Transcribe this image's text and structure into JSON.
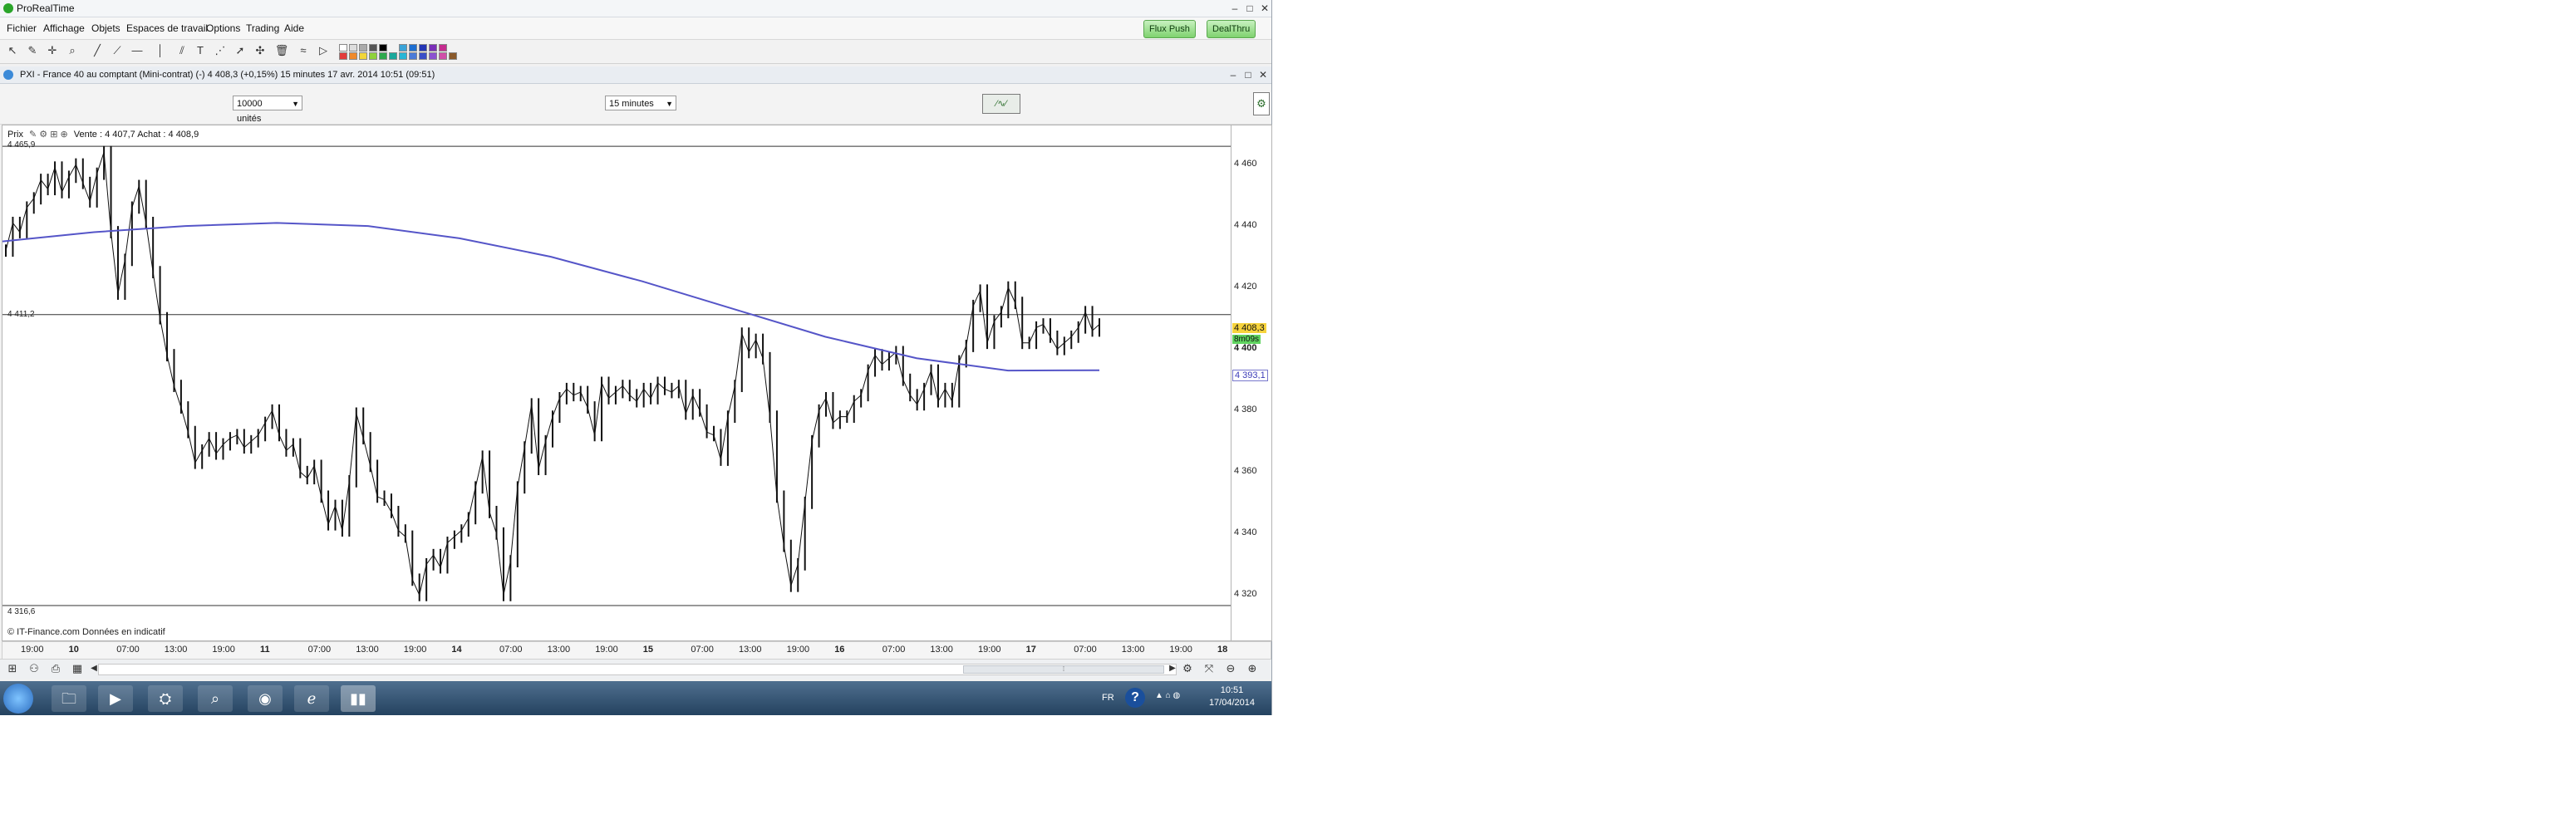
{
  "window": {
    "title": "ProRealTime",
    "controls": [
      "–",
      "□",
      "✕"
    ]
  },
  "menu": {
    "items": [
      "Fichier",
      "Affichage",
      "Objets",
      "Espaces de travail",
      "Options",
      "Trading",
      "Aide"
    ],
    "flux_push": "Flux Push",
    "dealthru": "DealThru"
  },
  "document": {
    "title": "PXI - France 40 au comptant (Mini-contrat)  (-)    4 408,3 (+0,15%)    15 minutes  17 avr. 2014 10:51 (09:51)"
  },
  "controls": {
    "units_value": "10000 unités",
    "timeframe_value": "15 minutes"
  },
  "chart": {
    "legend_label": "Prix",
    "legend_quote": "Vente : 4 407,7  Achat : 4 408,9",
    "line_high_label": "4 465,9",
    "line_mid_label": "4 411,2",
    "line_low_label": "4 316,6",
    "copyright": "© IT-Finance.com  Données en indicatif",
    "price_badge": "4 408,3",
    "countdown_badge": "8m09s",
    "ma_badge": "4 393,1",
    "colors": {
      "ma": "#5555c8",
      "candle": "#111111",
      "price_badge_bg": "#f6d33c",
      "countdown_bg": "#5fd35f"
    }
  },
  "chart_data": {
    "type": "line",
    "ylabel": "",
    "xlabel": "",
    "ylim": [
      4312,
      4470
    ],
    "y_ticks": [
      "4 460",
      "4 440",
      "4 420",
      "4 400",
      "4 380",
      "4 360",
      "4 340",
      "4 320"
    ],
    "x_ticks": [
      "19:00",
      "10",
      "07:00",
      "13:00",
      "19:00",
      "11",
      "07:00",
      "13:00",
      "19:00",
      "14",
      "07:00",
      "13:00",
      "19:00",
      "15",
      "07:00",
      "13:00",
      "19:00",
      "16",
      "07:00",
      "13:00",
      "19:00",
      "17",
      "07:00",
      "13:00",
      "19:00",
      "18"
    ],
    "bold_ticks": [
      "10",
      "11",
      "14",
      "15",
      "16",
      "17",
      "18"
    ],
    "horizontal_lines": [
      4465.9,
      4411.2,
      4316.6
    ],
    "series": [
      {
        "name": "",
        "values": [
          4432,
          4441,
          4438,
          4446,
          4449,
          4455,
          4452,
          4459,
          4451,
          4456,
          4460,
          4454,
          4448,
          4457,
          4464,
          4438,
          4418,
          4429,
          4446,
          4453,
          4441,
          4425,
          4410,
          4398,
          4388,
          4381,
          4373,
          4363,
          4367,
          4371,
          4366,
          4369,
          4371,
          4372,
          4368,
          4370,
          4372,
          4376,
          4380,
          4372,
          4367,
          4369,
          4360,
          4358,
          4362,
          4352,
          4343,
          4349,
          4341,
          4357,
          4379,
          4371,
          4362,
          4352,
          4351,
          4347,
          4341,
          4339,
          4325,
          4320,
          4330,
          4333,
          4329,
          4337,
          4339,
          4341,
          4345,
          4355,
          4365,
          4347,
          4340,
          4320,
          4331,
          4355,
          4368,
          4382,
          4361,
          4370,
          4378,
          4384,
          4387,
          4385,
          4386,
          4381,
          4372,
          4389,
          4384,
          4386,
          4388,
          4385,
          4383,
          4387,
          4384,
          4389,
          4387,
          4386,
          4388,
          4379,
          4385,
          4380,
          4373,
          4372,
          4364,
          4378,
          4388,
          4405,
          4399,
          4403,
          4397,
          4378,
          4352,
          4336,
          4323,
          4330,
          4350,
          4370,
          4380,
          4384,
          4376,
          4378,
          4378,
          4383,
          4385,
          4393,
          4398,
          4395,
          4397,
          4399,
          4390,
          4385,
          4382,
          4387,
          4393,
          4383,
          4387,
          4383,
          4396,
          4401,
          4414,
          4419,
          4402,
          4409,
          4412,
          4420,
          4415,
          4402,
          4402,
          4407,
          4408,
          4404,
          4400,
          4402,
          4404,
          4407,
          4412,
          4406,
          4408
        ]
      },
      {
        "name": "",
        "values": [
          4435,
          4438,
          4440,
          4441,
          4440,
          4436,
          4430,
          4422,
          4413,
          4404,
          4397,
          4393,
          4393.1
        ]
      }
    ]
  },
  "footer": {
    "nav_left": "◀",
    "nav_right": "▶"
  },
  "taskbar": {
    "lang": "FR",
    "time": "10:51",
    "date": "17/04/2014"
  }
}
